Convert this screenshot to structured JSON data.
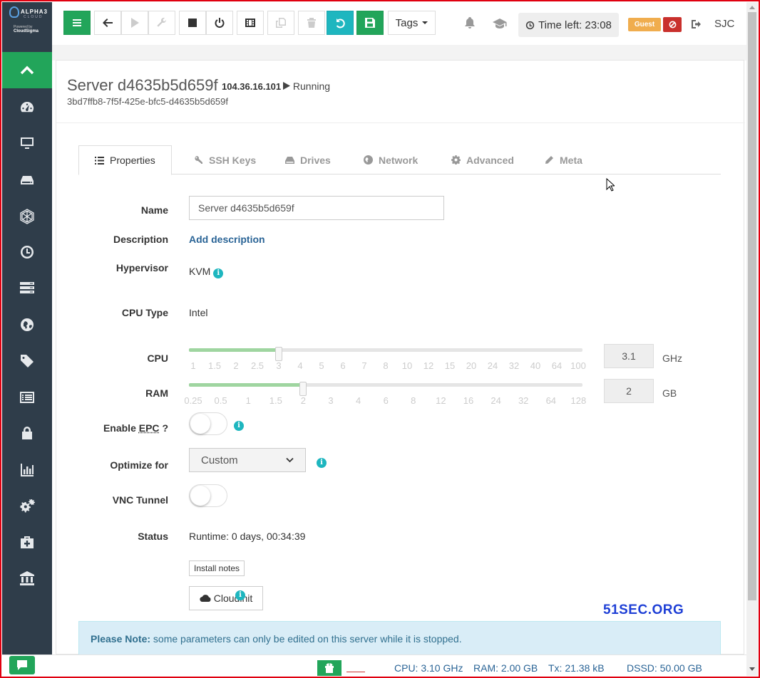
{
  "app": {
    "logo_title": "ALPHA3",
    "logo_sub": "CLOUD",
    "logo_powered": "Powered by",
    "logo_brand": "CloudSigma"
  },
  "toolbar": {
    "tags_label": "Tags",
    "time_left": "Time left: 23:08",
    "guest_badge": "Guest",
    "location": "SJC"
  },
  "server": {
    "name": "Server d4635b5d659f",
    "ip": "104.36.16.101",
    "state": "Running",
    "uuid": "3bd7ffb8-7f5f-425e-bfc5-d4635b5d659f"
  },
  "tabs": [
    {
      "label": "Properties",
      "icon": "list-icon"
    },
    {
      "label": "SSH Keys",
      "icon": "key-icon"
    },
    {
      "label": "Drives",
      "icon": "hdd-icon"
    },
    {
      "label": "Network",
      "icon": "globe-icon"
    },
    {
      "label": "Advanced",
      "icon": "gear-icon"
    },
    {
      "label": "Meta",
      "icon": "pencil-icon"
    }
  ],
  "form": {
    "name_label": "Name",
    "name_value": "Server d4635b5d659f",
    "description_label": "Description",
    "description_link": "Add description",
    "hypervisor_label": "Hypervisor",
    "hypervisor_value": "KVM",
    "cputype_label": "CPU Type",
    "cputype_value": "Intel",
    "cpu_label": "CPU",
    "cpu_value": "3.1",
    "cpu_unit": "GHz",
    "cpu_ticks": [
      "1",
      "1.5",
      "2",
      "2.5",
      "3",
      "4",
      "5",
      "6",
      "7",
      "8",
      "10",
      "12",
      "15",
      "20",
      "24",
      "32",
      "40",
      "64",
      "100"
    ],
    "cpu_selected_index": 4,
    "ram_label": "RAM",
    "ram_value": "2",
    "ram_unit": "GB",
    "ram_ticks": [
      "0.25",
      "0.5",
      "1",
      "1.5",
      "2",
      "3",
      "4",
      "6",
      "8",
      "12",
      "16",
      "24",
      "32",
      "64",
      "128"
    ],
    "ram_selected_index": 4,
    "epc_label": "Enable",
    "epc_abbr": "EPC",
    "epc_q": "?",
    "epc_enabled": false,
    "optimize_label": "Optimize for",
    "optimize_value": "Custom",
    "vnc_label": "VNC Tunnel",
    "vnc_enabled": false,
    "status_label": "Status",
    "status_value": "Runtime: 0 days, 00:34:39",
    "install_notes": "Install notes",
    "cloudinit": "Cloudinit"
  },
  "note": {
    "strong": "Please Note:",
    "text": " some parameters can only be edited on this server while it is stopped."
  },
  "watermark": "51SEC.ORG",
  "footer": {
    "cpu": "CPU: 3.10 GHz",
    "ram": "RAM: 2.00 GB",
    "tx": "Tx: 21.38 kB",
    "dssd": "DSSD: 50.00 GB"
  },
  "colors": {
    "green": "#22a55a",
    "teal": "#1eb6bf",
    "sidebar": "#2f3d4a",
    "guest": "#f0ad4e",
    "danger": "#c9302c"
  }
}
